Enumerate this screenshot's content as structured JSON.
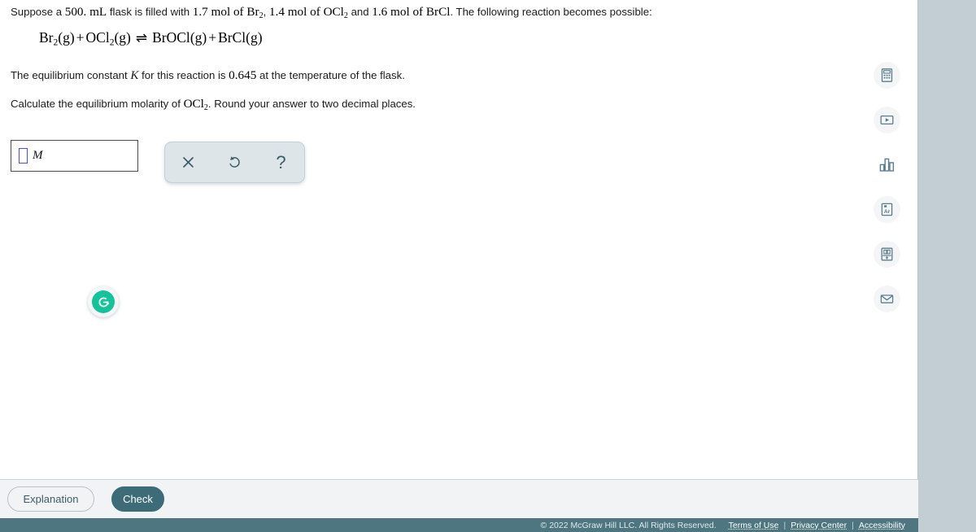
{
  "problem": {
    "intro_prefix": "Suppose a ",
    "volume": "500.",
    "volume_unit": " mL",
    "intro_mid": " flask is filled with ",
    "amount1": "1.7",
    "mol_label": " mol of ",
    "species1": "Br",
    "species1_sub": "2",
    "amount2": "1.4",
    "species2": "OCl",
    "species2_sub": "2",
    "conj": " and ",
    "amount3": "1.6",
    "species3": "BrCl",
    "intro_suffix": ". The following reaction becomes possible:",
    "comma": ", ",
    "equation": {
      "reactant1": "Br",
      "reactant1_sub": "2",
      "reactant1_state": "(g)",
      "plus": "+",
      "reactant2": "OCl",
      "reactant2_sub": "2",
      "reactant2_state": "(g)",
      "arrow": "⇌",
      "product1": "BrOCl",
      "product1_state": "(g)",
      "product2": "BrCl",
      "product2_state": "(g)"
    },
    "k_line_prefix": "The equilibrium constant ",
    "k_symbol": "K",
    "k_line_mid": " for this reaction is ",
    "k_value": "0.645",
    "k_line_suffix": " at the temperature of the flask.",
    "question_prefix": "Calculate the equilibrium molarity of ",
    "question_species": "OCl",
    "question_species_sub": "2",
    "question_suffix": ". Round your answer to two decimal places."
  },
  "answer": {
    "value": "",
    "placeholder": "",
    "unit": "M"
  },
  "mini_toolbar": {
    "clear_label": "×",
    "undo_label": "↺",
    "help_label": "?"
  },
  "icon_rail": {
    "items": [
      {
        "name": "calculator-icon",
        "label": "Calculator"
      },
      {
        "name": "video-player-icon",
        "label": "Video"
      },
      {
        "name": "bar-chart-icon",
        "label": "Data"
      },
      {
        "name": "periodic-table-icon",
        "label": "Ar"
      },
      {
        "name": "reference-book-icon",
        "label": "Reference"
      },
      {
        "name": "email-icon",
        "label": "Contact"
      }
    ]
  },
  "grammarly": {
    "label": "G"
  },
  "actions": {
    "explanation_label": "Explanation",
    "check_label": "Check"
  },
  "footer": {
    "copyright": "© 2022 McGraw Hill LLC. All Rights Reserved.",
    "terms_label": "Terms of Use",
    "privacy_label": "Privacy Center",
    "accessibility_label": "Accessibility",
    "separator": "|"
  },
  "colors": {
    "page_background": "#c2ced4",
    "content_background": "#ffffff",
    "footer_background": "#4d7681",
    "check_button": "#3d6b78",
    "accent_teal": "#3c5c69",
    "grammarly_green": "#15c39a",
    "placeholder_blue": "#4a4aee"
  }
}
